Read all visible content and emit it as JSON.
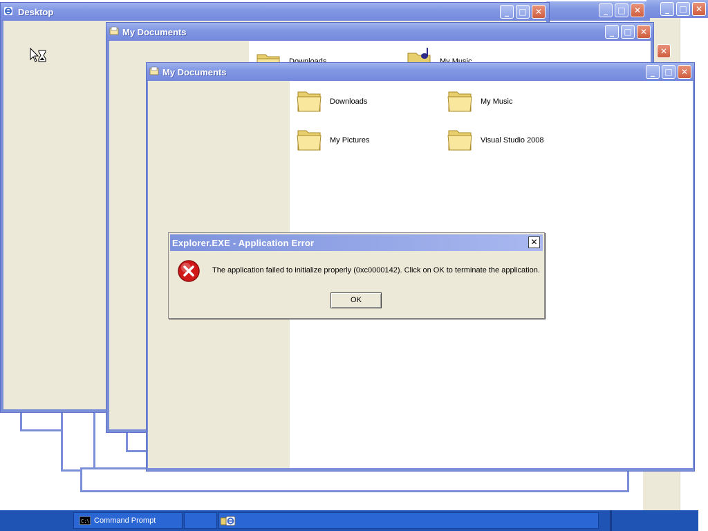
{
  "windows": {
    "desktop": {
      "title": "Desktop"
    },
    "docs_back": {
      "title": "My Documents",
      "folders": [
        "Downloads",
        "My Music"
      ]
    },
    "docs_front": {
      "title": "My Documents",
      "folders": [
        {
          "label": "Downloads",
          "icon": "folder-icon"
        },
        {
          "label": "My Music",
          "icon": "folder-icon"
        },
        {
          "label": "My Pictures",
          "icon": "folder-icon"
        },
        {
          "label": "Visual Studio 2008",
          "icon": "folder-icon"
        }
      ]
    },
    "window_buttons": {
      "minimize": "_",
      "maximize": "□",
      "close": "✕"
    }
  },
  "dialog": {
    "title": "Explorer.EXE - Application Error",
    "message": "The application failed to initialize properly (0xc0000142). Click on OK to terminate the application.",
    "ok_label": "OK",
    "close_glyph": "✕",
    "icon": "error-icon"
  },
  "taskbar": {
    "items": [
      {
        "label": "Command Prompt",
        "icon": "cmd-icon"
      },
      {
        "label": "",
        "icon": "explorer-icon"
      }
    ]
  },
  "colors": {
    "titlebar": "#8298e3",
    "window_frame": "#7b8ed8",
    "panel": "#ece9d8",
    "taskbar": "#1f54b4",
    "error_red": "#d01818"
  }
}
